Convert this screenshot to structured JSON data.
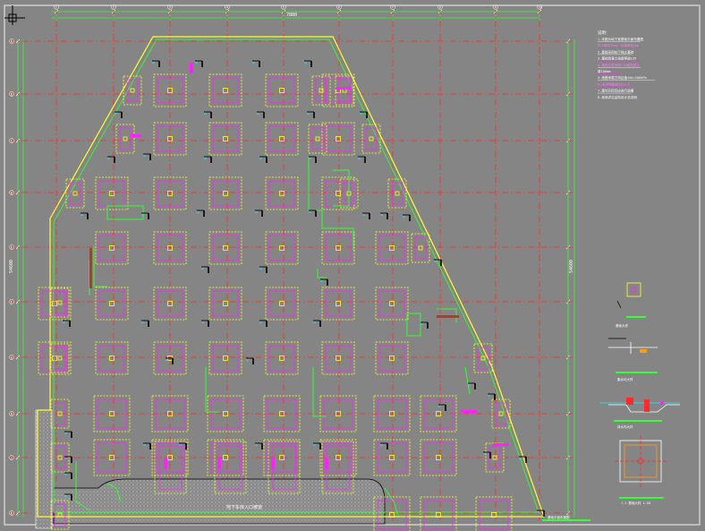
{
  "drawing": {
    "background": "#858585",
    "colors": {
      "axis_line": "#ff2a2a",
      "wall": "#ffff30",
      "green": "#31ff31",
      "magenta": "#ff22ff",
      "cyan": "#29e6ff",
      "white": "#ffffff",
      "black": "#000000",
      "orange": "#ff9a20"
    },
    "top_axis_labels": [
      "1",
      "2",
      "3",
      "4",
      "5",
      "6",
      "7",
      "8",
      "9",
      "10"
    ],
    "left_axis_labels": [
      "A",
      "B",
      "C",
      "D",
      "E",
      "F",
      "G",
      "H",
      "J",
      "K"
    ],
    "bottom_ramp_label": "地下车库入口坡道",
    "top_dimension": "7800",
    "side_dimension_left": "54600",
    "side_dimension_right": "54600",
    "notes": {
      "title": "说明：",
      "lines": [
        "1.本图为地下室基础平面布置图",
        "  尺寸单位为mm，标高单位为m",
        "2.基础采用柱下独立基础",
        "3.基础混凝土强度等级C35",
        "4.基底垃层采用C15素混凝土",
        "  厚100mm",
        "5.地基承载力特征值fak=180kPa",
        "6.未注明基础均为J-1",
        "7.基坑开挖后应进行验槽",
        "8.其他详见结构设计总说明"
      ]
    },
    "legend_caption_1": "基础大样",
    "legend_caption_2": "集水坑大样",
    "legend_caption_3": "排水沟大样",
    "legend_caption_4": "J-1 基础大样 1:50",
    "title_block": "基础平面布置图"
  }
}
